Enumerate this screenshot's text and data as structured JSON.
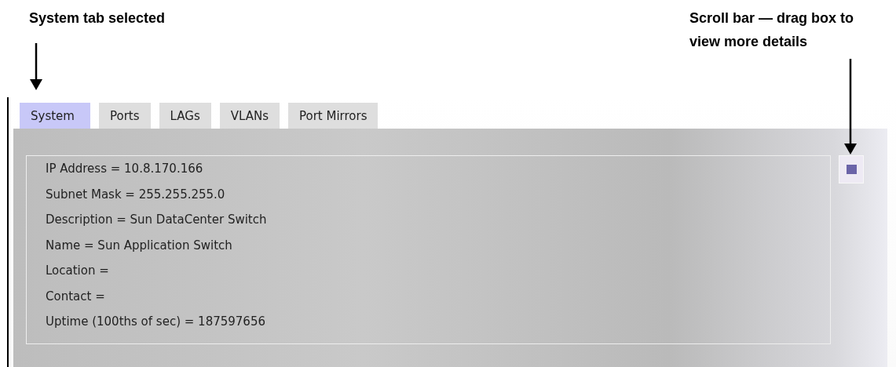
{
  "callouts": [
    {
      "text": "System tab selected",
      "kind": "left"
    },
    {
      "text": "Scroll bar — drag box to view more details",
      "kind": "right"
    }
  ],
  "tabs": [
    {
      "label": "System",
      "selected": true
    },
    {
      "label": "Ports",
      "selected": false
    },
    {
      "label": "LAGs",
      "selected": false
    },
    {
      "label": "VLANs",
      "selected": false
    },
    {
      "label": "Port Mirrors",
      "selected": false
    }
  ],
  "details": [
    "IP Address = 10.8.170.166",
    "Subnet Mask = 255.255.255.0",
    "Description = Sun DataCenter Switch",
    "Name = Sun Application Switch",
    "Location =",
    "Contact =",
    "Uptime (100ths of sec) = 187597656"
  ]
}
